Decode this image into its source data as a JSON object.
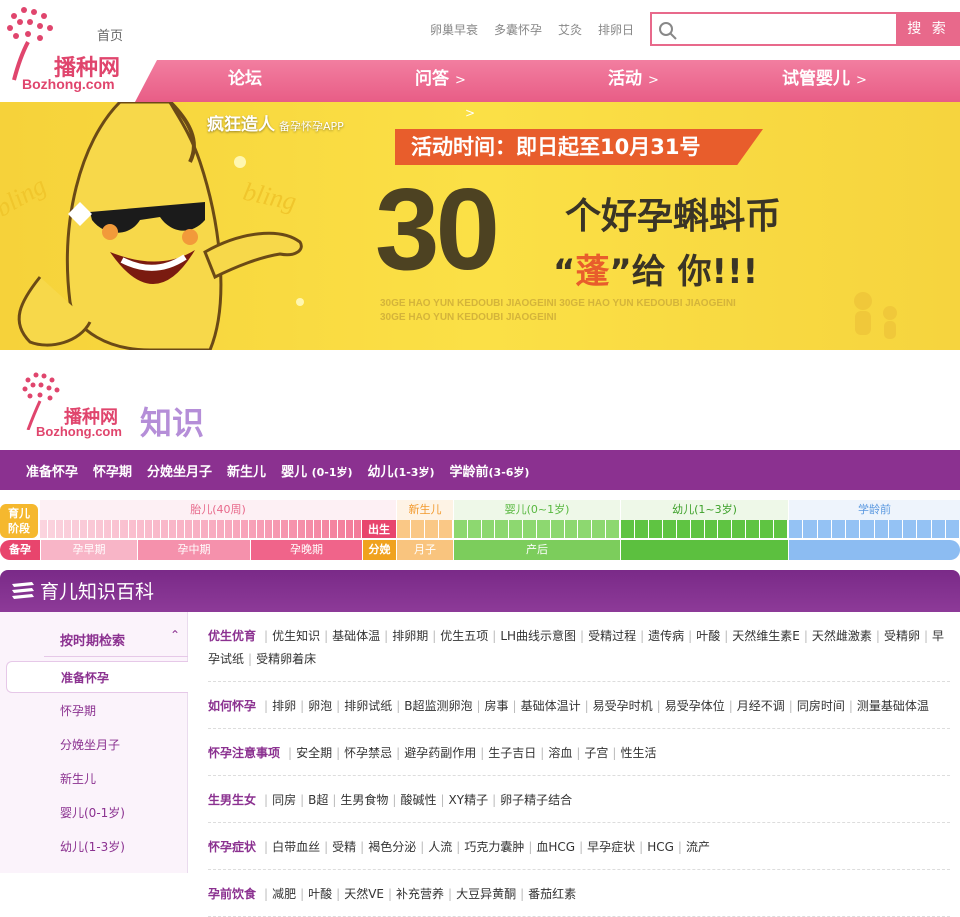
{
  "header": {
    "logo_text": "播种网",
    "logo_sub": "Bozhong.com",
    "home": "首页",
    "toplinks": [
      "卵巢早衰",
      "多囊怀孕",
      "艾灸",
      "排卵日"
    ],
    "search_placeholder": "",
    "search_button": "搜 索",
    "nav": [
      "论坛",
      "问答",
      "活动",
      "试管婴儿"
    ]
  },
  "banner": {
    "brand": "疯狂造人",
    "brand_sub": "备孕怀孕APP",
    "ribbon": "活动时间：即日起至10月31号",
    "big": "30",
    "line1": "个好孕蝌蚪币",
    "line2_a": "“",
    "line2_hi": "蓬",
    "line2_b": "”给",
    "line2_c": "你!!!",
    "pinyin1": "30GE HAO YUN KEDOUBI JIAOGEINI  30GE HAO YUN KEDOUBI JIAOGEINI",
    "pinyin2": "30GE HAO YUN KEDOUBI JIAOGEINI",
    "bling": "bling"
  },
  "knowledge": {
    "logo_text": "播种网",
    "logo_sub": "Bozhong.com",
    "title": "知识"
  },
  "categories": [
    {
      "label": "准备怀孕",
      "age": ""
    },
    {
      "label": "怀孕期",
      "age": ""
    },
    {
      "label": "分娩坐月子",
      "age": ""
    },
    {
      "label": "新生儿",
      "age": ""
    },
    {
      "label": "婴儿",
      "age": "(0-1岁)"
    },
    {
      "label": "幼儿",
      "age": "(1-3岁)"
    },
    {
      "label": "学龄前",
      "age": "(3-6岁)"
    }
  ],
  "stage": {
    "badge1": "育儿",
    "badge2": "阶段",
    "top": [
      "胎儿(40周)",
      "新生儿",
      "婴儿(0~1岁)",
      "幼儿(1~3岁)",
      "学龄前"
    ],
    "birth": "出生",
    "bottom": [
      "备孕",
      "孕早期",
      "孕中期",
      "孕晚期",
      "分娩",
      "月子",
      "产后"
    ]
  },
  "panel": {
    "title": "育儿知识百科"
  },
  "sidebar": {
    "heading": "按时期检索",
    "items": [
      "准备怀孕",
      "怀孕期",
      "分娩坐月子",
      "新生儿",
      "婴儿(0-1岁)",
      "幼儿(1-3岁)"
    ]
  },
  "sections": [
    {
      "title": "优生优育",
      "links": [
        "优生知识",
        "基础体温",
        "排卵期",
        "优生五项",
        "LH曲线示意图",
        "受精过程",
        "遗传病",
        "叶酸",
        "天然维生素E",
        "天然雌激素",
        "受精卵",
        "早孕试纸",
        "受精卵着床"
      ]
    },
    {
      "title": "如何怀孕",
      "links": [
        "排卵",
        "卵泡",
        "排卵试纸",
        "B超监测卵泡",
        "房事",
        "基础体温计",
        "易受孕时机",
        "易受孕体位",
        "月经不调",
        "同房时间",
        "测量基础体温"
      ]
    },
    {
      "title": "怀孕注意事项",
      "links": [
        "安全期",
        "怀孕禁忌",
        "避孕药副作用",
        "生子吉日",
        "溶血",
        "子宫",
        "性生活"
      ]
    },
    {
      "title": "生男生女",
      "links": [
        "同房",
        "B超",
        "生男食物",
        "酸碱性",
        "XY精子",
        "卵子精子结合"
      ]
    },
    {
      "title": "怀孕症状",
      "links": [
        "白带血丝",
        "受精",
        "褐色分泌",
        "人流",
        "巧克力囊肿",
        "血HCG",
        "早孕症状",
        "HCG",
        "流产"
      ]
    },
    {
      "title": "孕前饮食",
      "links": [
        "减肥",
        "叶酸",
        "天然VE",
        "补充营养",
        "大豆异黄酮",
        "番茄红素"
      ]
    }
  ],
  "colors": {
    "pink": "#e8698b",
    "purple": "#8b3190",
    "banner_yellow": "#fbe046"
  }
}
